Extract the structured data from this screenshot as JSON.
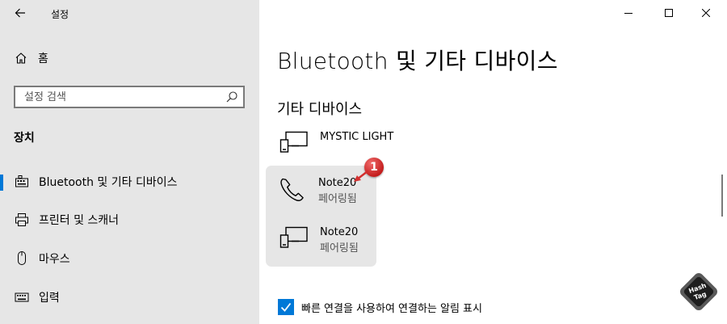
{
  "window": {
    "title": "설정",
    "controls": [
      "minimize",
      "maximize",
      "close"
    ]
  },
  "sidebar": {
    "home_label": "홈",
    "search_placeholder": "설정 검색",
    "section_title": "장치",
    "items": [
      {
        "label": "Bluetooth 및 기타 디바이스",
        "icon": "bluetooth-device-icon",
        "active": true
      },
      {
        "label": "프린터 및 스캐너",
        "icon": "printer-icon",
        "active": false
      },
      {
        "label": "마우스",
        "icon": "mouse-icon",
        "active": false
      },
      {
        "label": "입력",
        "icon": "keyboard-icon",
        "active": false
      }
    ]
  },
  "main": {
    "page_title": "Bluetooth 및 기타 디바이스",
    "section_title": "기타 디바이스",
    "devices": [
      {
        "name": "MYSTIC LIGHT",
        "status": "",
        "icon": "generic-device-icon"
      },
      {
        "name": "Note20",
        "status": "페어링됨",
        "icon": "phone-icon"
      },
      {
        "name": "Note20",
        "status": "페어링됨",
        "icon": "generic-device-icon"
      }
    ],
    "badge_number": "1",
    "checkbox_label": "빠른 연결을 사용하여 연결하는 알림 표시",
    "checkbox_checked": true
  },
  "watermark": {
    "line1": "Hash",
    "line2": "Tag"
  },
  "colors": {
    "accent": "#0078d7",
    "sidebar_bg": "#e6e6e6",
    "badge": "#d32f2f"
  }
}
